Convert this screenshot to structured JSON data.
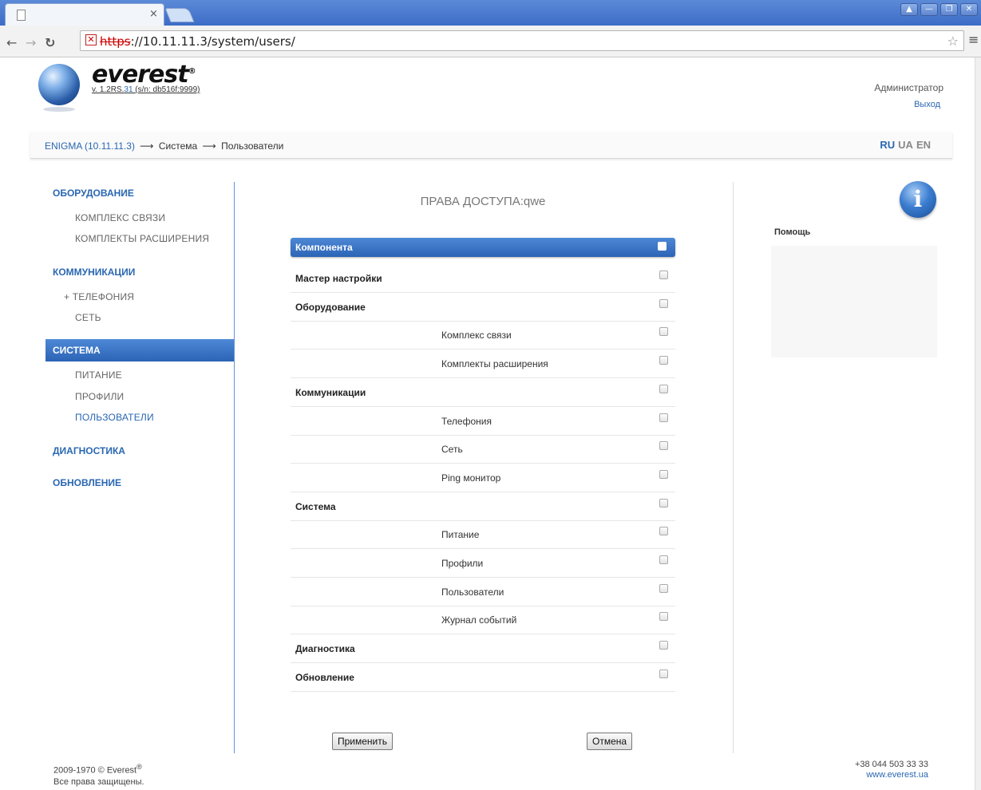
{
  "browser": {
    "tab_close": "×",
    "url_scheme": "https",
    "url_rest": "://10.11.11.3/system/users/"
  },
  "header": {
    "brand": "everest",
    "brand_mark": "®",
    "version_prefix": "v. 1.2RS.",
    "version_link": "31",
    "version_suffix": " (s/n: db516f:9999)",
    "user": "Администратор",
    "logout": "Выход"
  },
  "breadcrumb": {
    "root": "ENIGMA (10.11.11.3)",
    "sep": "⟶",
    "level1": "Система",
    "level2": "Пользователи"
  },
  "languages": [
    "RU",
    "UA",
    "EN"
  ],
  "nav": {
    "hardware": "ОБОРУДОВАНИЕ",
    "hardware_complex": "КОМПЛЕКС СВЯЗИ",
    "hardware_kits": "КОМПЛЕКТЫ РАСШИРЕНИЯ",
    "comms": "КОММУНИКАЦИИ",
    "comms_telephony": "+ ТЕЛЕФОНИЯ",
    "comms_network": "СЕТЬ",
    "system": "СИСТЕМА",
    "system_power": "ПИТАНИЕ",
    "system_profiles": "ПРОФИЛИ",
    "system_users": "ПОЛЬЗОВАТЕЛИ",
    "diagnostics": "ДИАГНОСТИКА",
    "update": "ОБНОВЛЕНИЕ"
  },
  "main": {
    "title": "ПРАВА ДОСТУПА:qwe",
    "column_header": "Компонента",
    "rows": [
      {
        "label": "Мастер настройки",
        "level": "top"
      },
      {
        "label": "Оборудование",
        "level": "top"
      },
      {
        "label": "Комплекс связи",
        "level": "sub"
      },
      {
        "label": "Комплекты расширения",
        "level": "sub"
      },
      {
        "label": "Коммуникации",
        "level": "top"
      },
      {
        "label": "Телефония",
        "level": "sub"
      },
      {
        "label": "Сеть",
        "level": "sub"
      },
      {
        "label": "Ping монитор",
        "level": "sub"
      },
      {
        "label": "Система",
        "level": "top"
      },
      {
        "label": "Питание",
        "level": "sub"
      },
      {
        "label": "Профили",
        "level": "sub"
      },
      {
        "label": "Пользователи",
        "level": "sub"
      },
      {
        "label": "Журнал событий",
        "level": "sub"
      },
      {
        "label": "Диагностика",
        "level": "top"
      },
      {
        "label": "Обновление",
        "level": "top"
      }
    ],
    "apply": "Применить",
    "cancel": "Отмена"
  },
  "help": {
    "icon": "i",
    "title": "Помощь"
  },
  "footer": {
    "copyright": "2009-1970 © Everest",
    "copyright_mark": "®",
    "rights": "Все права защищены.",
    "phone": "+38 044 503 33 33",
    "site": "www.everest.ua"
  }
}
